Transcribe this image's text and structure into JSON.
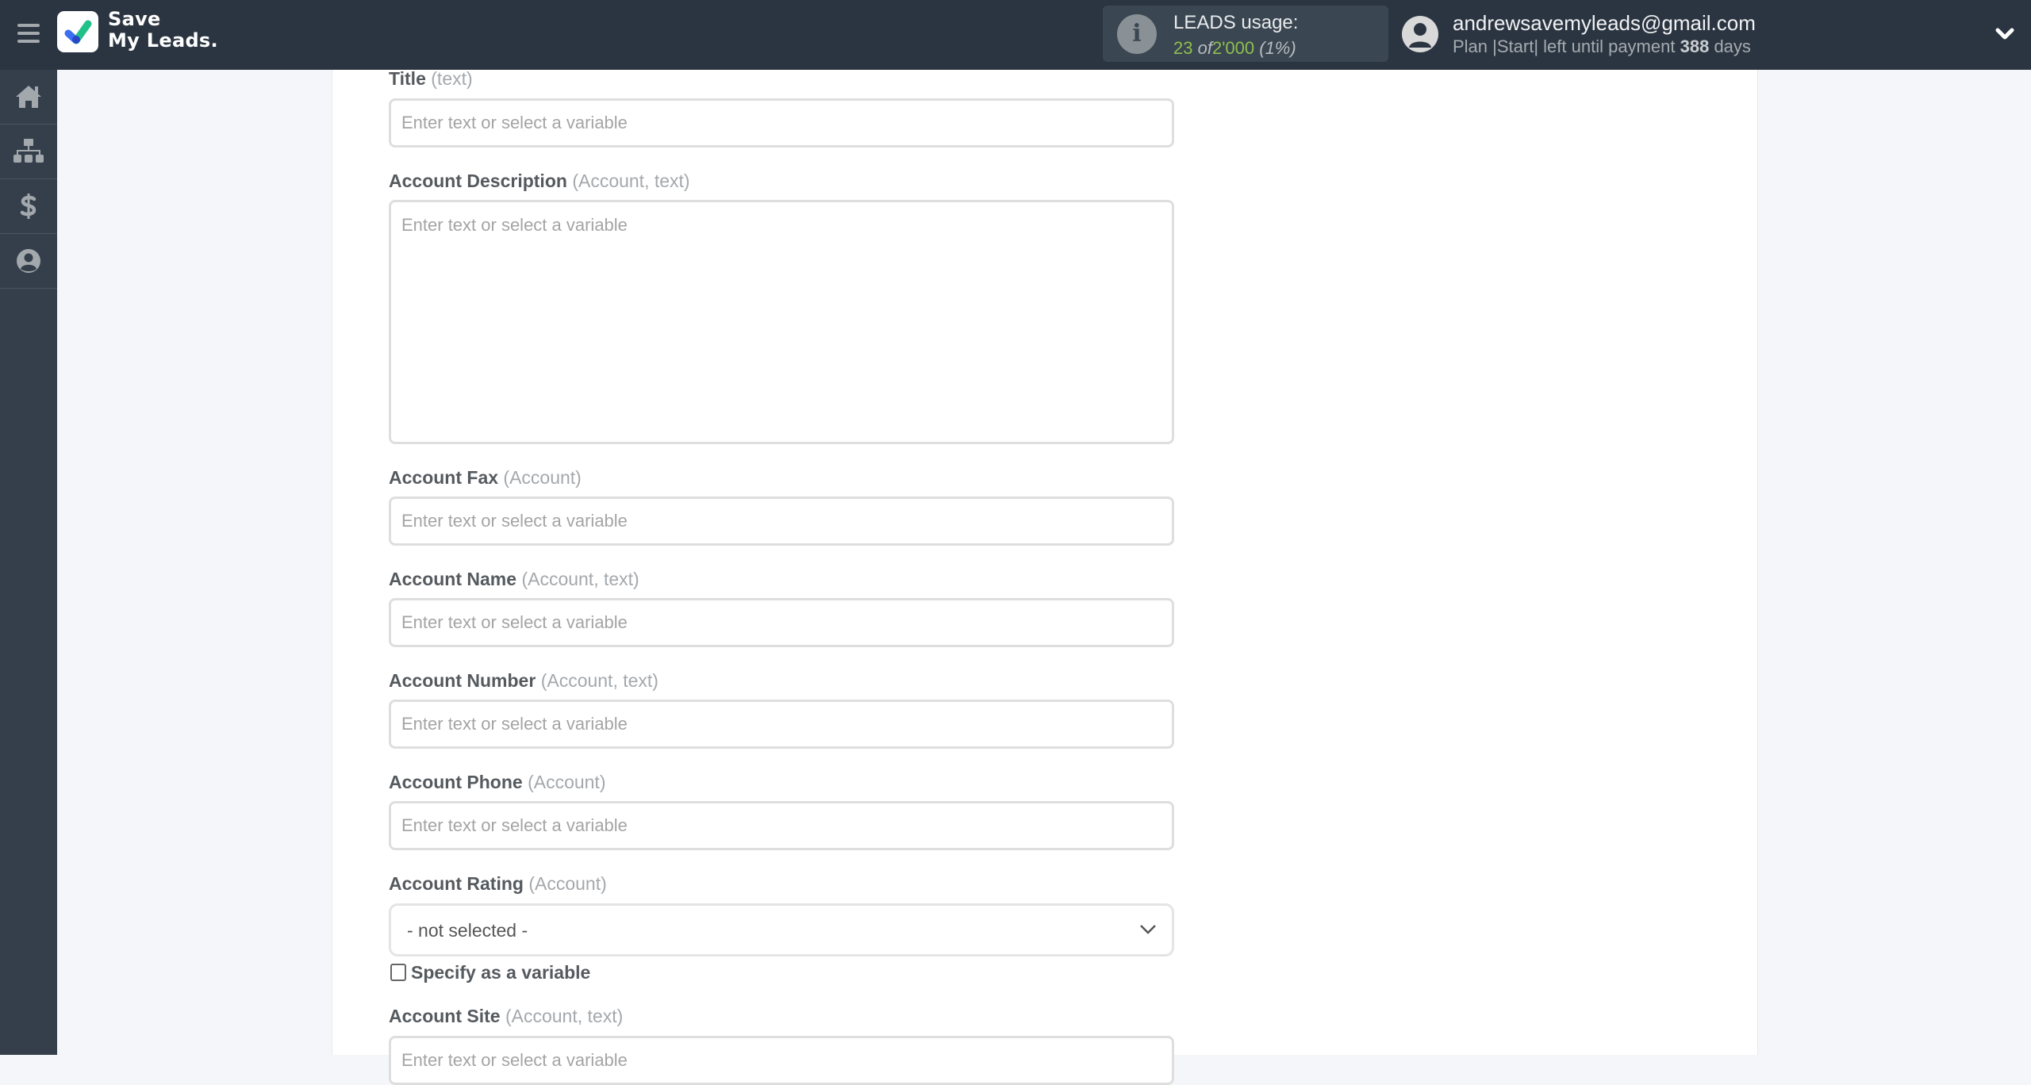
{
  "header": {
    "logo_line1": "Save",
    "logo_line2": "My Leads.",
    "leads": {
      "title": "LEADS usage:",
      "used": "23",
      "of": "of",
      "limit": "2'000",
      "percent": "(1%)"
    },
    "user": {
      "email": "andrewsavemyleads@gmail.com",
      "plan_prefix": "Plan |Start| left until payment",
      "days": "388",
      "days_suffix": "days"
    }
  },
  "sidebar": {
    "items": [
      {
        "name": "home",
        "icon": "home-icon"
      },
      {
        "name": "connections",
        "icon": "sitemap-icon"
      },
      {
        "name": "billing",
        "icon": "dollar-icon"
      },
      {
        "name": "account",
        "icon": "user-circle-icon"
      }
    ]
  },
  "form": {
    "placeholder": "Enter text or select a variable",
    "fields": [
      {
        "label": "Title",
        "hint": "(text)",
        "value": ""
      },
      {
        "label": "Account Description",
        "hint": "(Account, text)",
        "value": ""
      },
      {
        "label": "Account Fax",
        "hint": "(Account)",
        "value": ""
      },
      {
        "label": "Account Name",
        "hint": "(Account, text)",
        "value": ""
      },
      {
        "label": "Account Number",
        "hint": "(Account, text)",
        "value": ""
      },
      {
        "label": "Account Phone",
        "hint": "(Account)",
        "value": ""
      },
      {
        "label": "Account Rating",
        "hint": "(Account)",
        "selected": "- not selected -",
        "checkbox_label": "Specify as a variable",
        "checkbox_checked": false
      },
      {
        "label": "Account Site",
        "hint": "(Account, text)",
        "value": ""
      }
    ]
  },
  "colors": {
    "header_bg": "#2b3541",
    "sidebar_bg": "#353f4b",
    "usage_green": "#8fbf4f",
    "logo_green": "#22c18a",
    "logo_blue": "#3b6ef0"
  }
}
